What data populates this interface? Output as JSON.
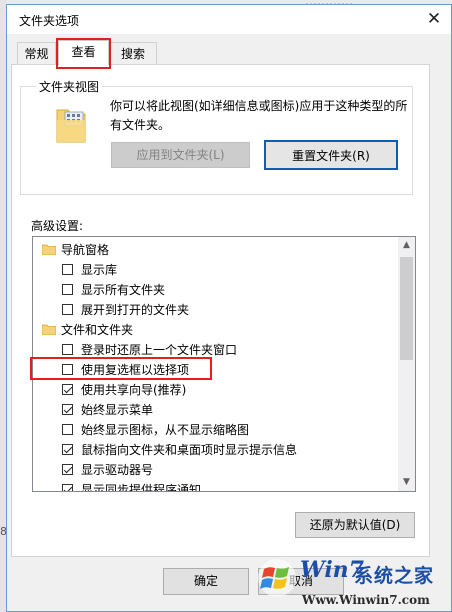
{
  "background_fragment": "…………",
  "left_edge_glyph": "8",
  "window": {
    "title": "文件夹选项",
    "close_glyph": "✕"
  },
  "tabs": [
    {
      "label": "常规",
      "active": false
    },
    {
      "label": "查看",
      "active": true
    },
    {
      "label": "搜索",
      "active": false
    }
  ],
  "folder_views": {
    "legend": "文件夹视图",
    "description": "你可以将此视图(如详细信息或图标)应用于这种类型的所有文件夹。",
    "apply_button": "应用到文件夹(L)",
    "reset_button": "重置文件夹(R)"
  },
  "advanced": {
    "label": "高级设置:",
    "items": [
      {
        "type": "folder",
        "label": "导航窗格"
      },
      {
        "type": "checkbox",
        "label": "显示库",
        "checked": false
      },
      {
        "type": "checkbox",
        "label": "显示所有文件夹",
        "checked": false
      },
      {
        "type": "checkbox",
        "label": "展开到打开的文件夹",
        "checked": false
      },
      {
        "type": "folder",
        "label": "文件和文件夹"
      },
      {
        "type": "checkbox",
        "label": "登录时还原上一个文件夹窗口",
        "checked": false
      },
      {
        "type": "checkbox",
        "label": "使用复选框以选择项",
        "checked": false
      },
      {
        "type": "checkbox",
        "label": "使用共享向导(推荐)",
        "checked": true
      },
      {
        "type": "checkbox",
        "label": "始终显示菜单",
        "checked": true
      },
      {
        "type": "checkbox",
        "label": "始终显示图标，从不显示缩略图",
        "checked": false
      },
      {
        "type": "checkbox",
        "label": "鼠标指向文件夹和桌面项时显示提示信息",
        "checked": true
      },
      {
        "type": "checkbox",
        "label": "显示驱动器号",
        "checked": true
      },
      {
        "type": "checkbox",
        "label": "显示同步提供程序通知",
        "checked": true
      }
    ],
    "restore_button": "还原为默认值(D)"
  },
  "footer": {
    "ok_button": "确定",
    "cancel_button": "取消"
  },
  "watermark": {
    "brand": "Win7",
    "brand_cn": "系统之家",
    "url": "Www.Winwin7.com"
  },
  "colors": {
    "highlight_red": "#e41f1f",
    "focus_blue": "#0a5fb4",
    "watermark_blue": "#1d4ea5"
  }
}
